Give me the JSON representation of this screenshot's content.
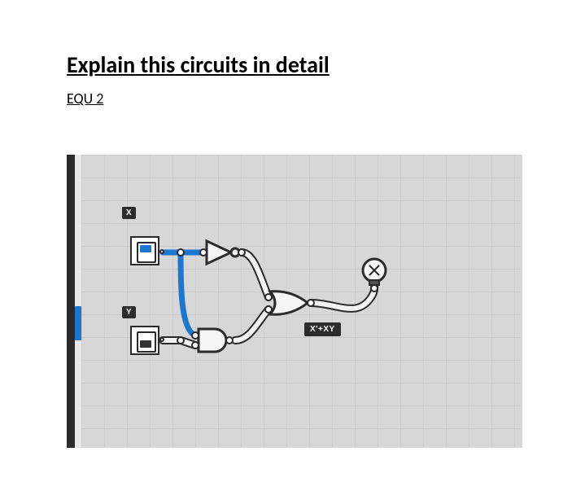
{
  "heading": "Explain this circuits in detail",
  "subheading": "EQU 2",
  "inputs": {
    "x": {
      "label": "X",
      "state": "on"
    },
    "y": {
      "label": "Y",
      "state": "off"
    }
  },
  "gates": [
    {
      "id": "not",
      "type": "NOT",
      "inputs": [
        "X"
      ],
      "output": "X'"
    },
    {
      "id": "and",
      "type": "AND",
      "inputs": [
        "X",
        "Y"
      ],
      "output": "XY"
    },
    {
      "id": "or",
      "type": "OR",
      "inputs": [
        "X'",
        "XY"
      ],
      "output": "X'+XY"
    }
  ],
  "output": {
    "type": "bulb",
    "expression_label": "X'+XY"
  },
  "colors": {
    "wire_active": "#1c77d0",
    "wire_idle": "#f2f2f2",
    "canvas_bg": "#d7d7d7",
    "node_outline": "#2b2b2b"
  }
}
